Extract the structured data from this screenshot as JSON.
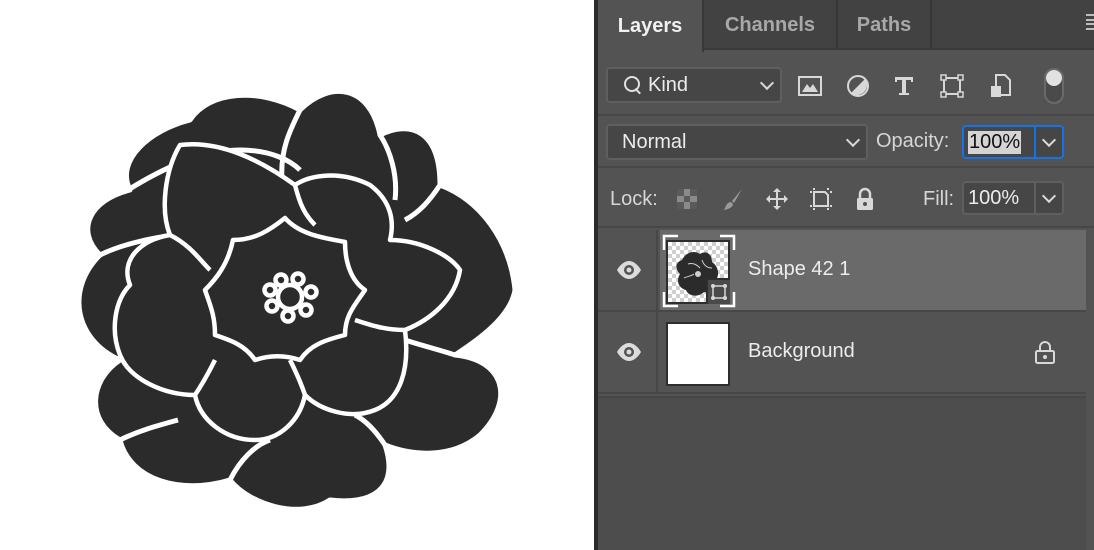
{
  "canvas": {
    "artwork": "flower-shape-icon",
    "fill_color": "#2b2b2b",
    "background_color": "#ffffff"
  },
  "panel": {
    "tabs": [
      {
        "label": "Layers",
        "active": true
      },
      {
        "label": "Channels",
        "active": false
      },
      {
        "label": "Paths",
        "active": false
      }
    ],
    "menu_icon": "hamburger-menu-icon",
    "filter": {
      "kind_label": "Kind",
      "icons": [
        "image-filter-icon",
        "adjustment-filter-icon",
        "type-filter-icon",
        "shape-filter-icon",
        "smart-object-filter-icon"
      ],
      "toggle_on": true
    },
    "blend": {
      "mode": "Normal",
      "opacity_label": "Opacity:",
      "opacity_value": "100%"
    },
    "lock": {
      "label": "Lock:",
      "icons": [
        "lock-transparent-pixels-icon",
        "lock-image-pixels-icon",
        "lock-position-icon",
        "lock-artboard-icon",
        "lock-all-icon"
      ],
      "fill_label": "Fill:",
      "fill_value": "100%"
    },
    "layers": [
      {
        "name": "Shape 42 1",
        "visible": true,
        "selected": true,
        "type": "shape",
        "locked": false
      },
      {
        "name": "Background",
        "visible": true,
        "selected": false,
        "type": "background",
        "locked": true
      }
    ],
    "accent_color": "#1473e6"
  }
}
